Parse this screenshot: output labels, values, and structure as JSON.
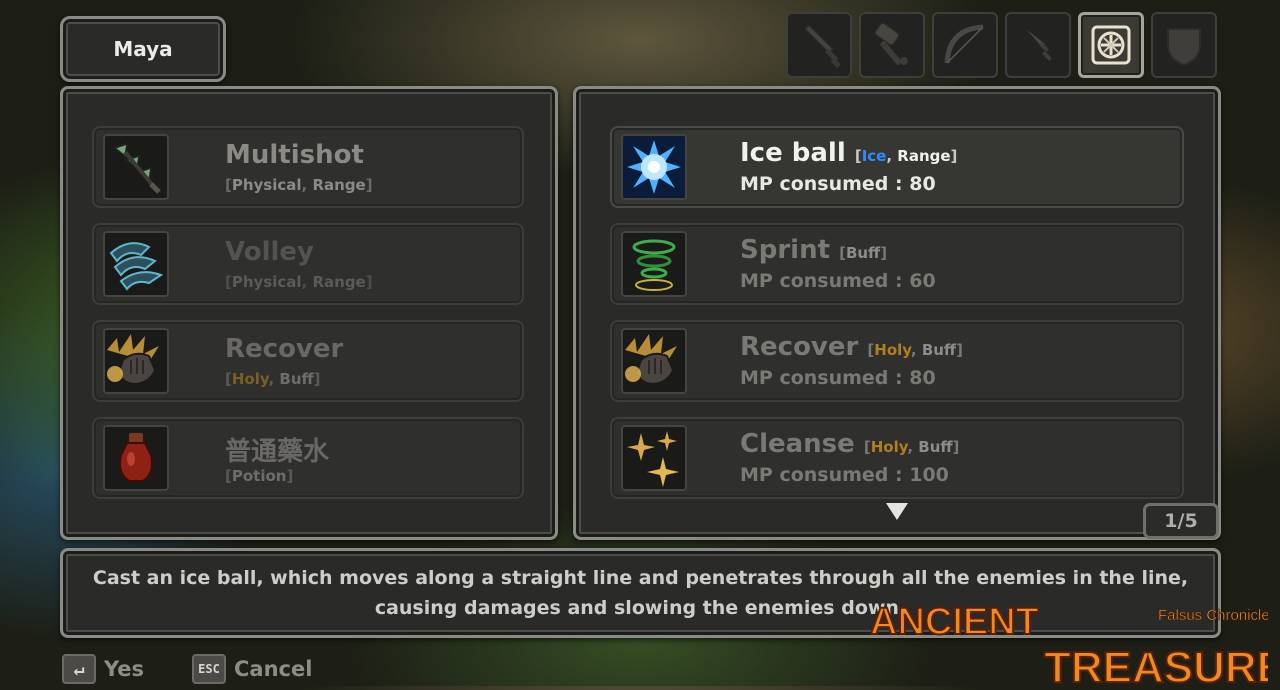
{
  "character": {
    "name": "Maya"
  },
  "tabs": [
    {
      "name": "sword",
      "active": false
    },
    {
      "name": "hammer",
      "active": false
    },
    {
      "name": "bow",
      "active": false
    },
    {
      "name": "dagger",
      "active": false
    },
    {
      "name": "magic-rune",
      "active": true
    },
    {
      "name": "shield",
      "active": false
    }
  ],
  "equipped_skills": [
    {
      "name": "Multishot",
      "tag_open": "[",
      "tag_1": "Physical",
      "sep": ", ",
      "tag_2": "Range",
      "tag_close": "]",
      "icon": "arrows-icon"
    },
    {
      "name": "Volley",
      "tag_open": "[",
      "tag_1": "Physical",
      "sep": ", ",
      "tag_2": "Range",
      "tag_close": "]",
      "icon": "volley-icon"
    },
    {
      "name": "Recover",
      "tag_open": "[",
      "tag_1": "Holy",
      "sep": ", ",
      "tag_2": "Buff",
      "tag_close": "]",
      "icon": "recover-hand-icon"
    },
    {
      "name": "普通藥水",
      "tag_open": "[",
      "tag_1": "Potion",
      "tag_close": "]",
      "icon": "potion-icon"
    }
  ],
  "skill_list": [
    {
      "name": "Ice ball",
      "tag_open": "[",
      "tag_1": "Ice",
      "sep": ", ",
      "tag_2": "Range",
      "tag_close": "]",
      "mp": "MP consumed : 80",
      "icon": "ice-ball-icon",
      "selected": true
    },
    {
      "name": "Sprint",
      "tag_open": "[",
      "tag_1": "Buff",
      "tag_close": "]",
      "mp": "MP consumed : 60",
      "icon": "sprint-icon",
      "selected": false
    },
    {
      "name": "Recover",
      "tag_open": "[",
      "tag_1": "Holy",
      "sep": ", ",
      "tag_2": "Buff",
      "tag_close": "]",
      "mp": "MP consumed : 80",
      "icon": "recover-hand-icon",
      "selected": false
    },
    {
      "name": "Cleanse",
      "tag_open": "[",
      "tag_1": "Holy",
      "sep": ", ",
      "tag_2": "Buff",
      "tag_close": "]",
      "mp": "MP consumed : 100",
      "icon": "sparkles-icon",
      "selected": false
    }
  ],
  "pagination": {
    "label": "1/5"
  },
  "description": "Cast an ice ball, which moves along a straight line and penetrates through all the enemies in the line, causing damages and slowing the enemies down.",
  "footer": {
    "confirm_key": "↵",
    "confirm_label": "Yes",
    "cancel_key": "ESC",
    "cancel_label": "Cancel"
  },
  "logo": {
    "line1": "ANCIENT",
    "line2": "TREASURE",
    "subtitle": "Falsus Chronicle"
  },
  "colors": {
    "ice_tag": "#2f8bff",
    "holy_tag": "#b27f1e",
    "frame": "#8b8b86",
    "panel": "#2a2a28"
  }
}
